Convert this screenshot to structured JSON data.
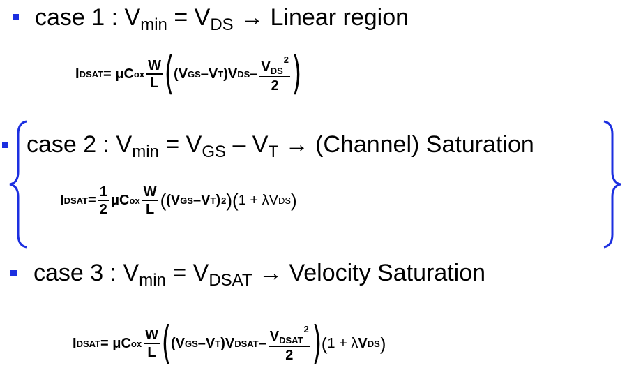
{
  "case1": {
    "prefix": "case 1 : V",
    "sub1": "min",
    "mid": " = V",
    "sub2": "DS",
    "arrow": " → Linear region"
  },
  "case2": {
    "prefix": "case 2 : V",
    "sub1": "min",
    "mid": " = V",
    "sub2": "GS",
    "mid2": " – V",
    "sub3": "T",
    "arrow": " → (Channel) Saturation"
  },
  "case3": {
    "prefix": "case 3 : V",
    "sub1": "min",
    "mid": " = V",
    "sub2": "DSAT",
    "arrow": " → Velocity Saturation"
  },
  "eq_text": {
    "I": "I",
    "DSAT": "DSAT",
    "eq_mu": " = μC",
    "ox": "ox",
    "W": "W",
    "L": "L",
    "V": "V",
    "GS": "GS",
    "minus": " – ",
    "VT_close": "V",
    "T": "T",
    "DS": "DS",
    "two": "2",
    "one": "1",
    "one_plus_lambda": "1 + λV",
    "close_sq": ")",
    "sq": "2"
  },
  "colors": {
    "bullet": "#1c2fe0",
    "brace": "#1c2fe0"
  }
}
